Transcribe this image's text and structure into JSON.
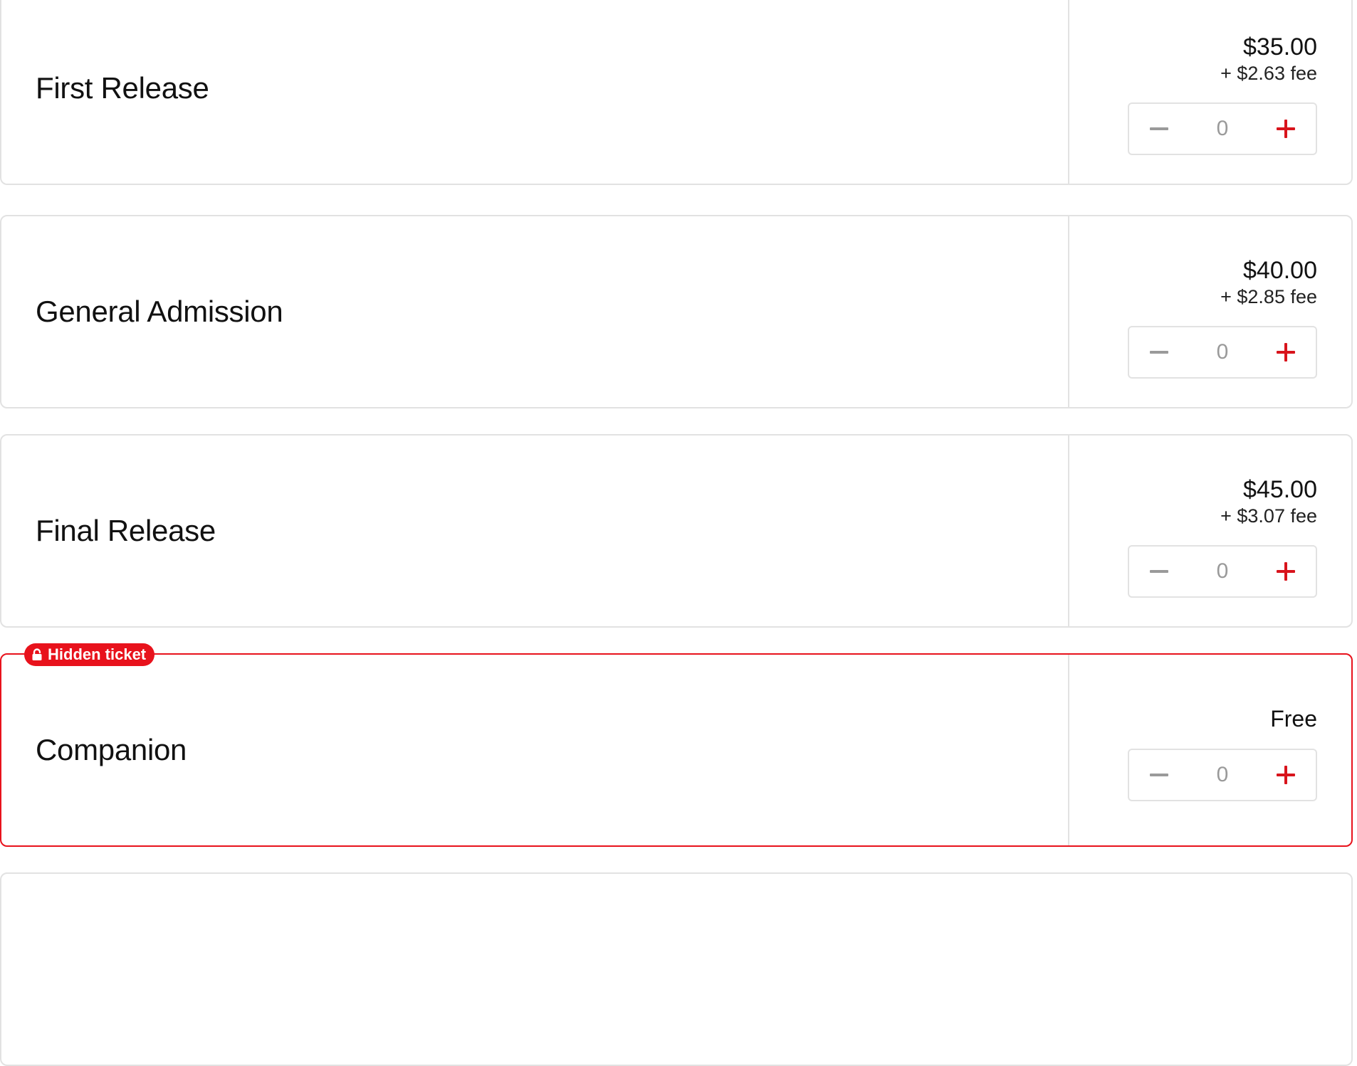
{
  "tickets": [
    {
      "name": "First Release",
      "price": "$35.00",
      "fee": "+ $2.63 fee",
      "quantity": "0"
    },
    {
      "name": "General Admission",
      "price": "$40.00",
      "fee": "+ $2.85 fee",
      "quantity": "0"
    },
    {
      "name": "Final Release",
      "price": "$45.00",
      "fee": "+ $3.07 fee",
      "quantity": "0"
    },
    {
      "name": "Companion",
      "price": "Free",
      "badge": "Hidden ticket",
      "quantity": "0"
    }
  ],
  "icons": {
    "decrement": "minus-icon",
    "increment": "plus-icon",
    "badge": "lock-icon"
  },
  "colors": {
    "accent": "#e8121c",
    "border": "#e2e2e2",
    "muted": "#9a9a9a"
  }
}
